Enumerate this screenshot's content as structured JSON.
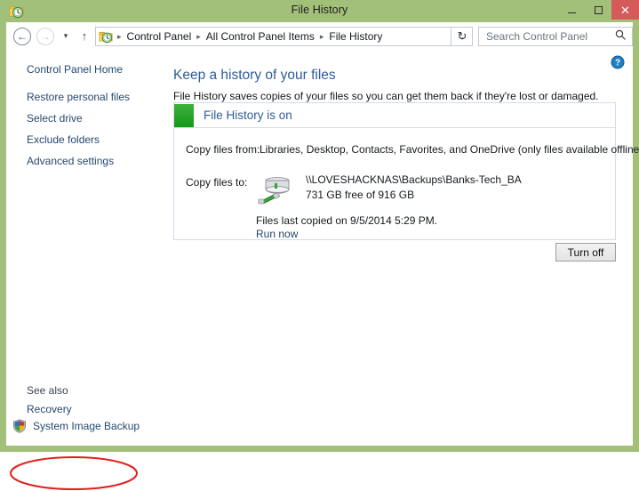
{
  "window": {
    "title": "File History",
    "icon": "file-history-folder-clock-icon",
    "frame_color": "#a3c07a",
    "controls": {
      "minimize": "–",
      "maximize": "□",
      "close": "✕",
      "close_color": "#d55b5b"
    }
  },
  "nav": {
    "back": "←",
    "forward": "→",
    "recent": "▾",
    "up": "↑",
    "address_icon": "file-history-folder-clock-icon",
    "breadcrumbs": [
      "Control Panel",
      "All Control Panel Items",
      "File History"
    ],
    "separator": "▸",
    "dropdown": "⌄",
    "refresh": "↻"
  },
  "search": {
    "placeholder": "Search Control Panel",
    "value": "",
    "icon": "search-icon"
  },
  "help": {
    "icon": "help-question-icon",
    "glyph": "?"
  },
  "sidebar": {
    "home": "Control Panel Home",
    "items": [
      "Restore personal files",
      "Select drive",
      "Exclude folders",
      "Advanced settings"
    ],
    "see_also_label": "See also",
    "see_also_items": [
      "Recovery",
      "System Image Backup"
    ],
    "shield_icon": "uac-shield-icon"
  },
  "main": {
    "heading": "Keep a history of your files",
    "subheading": "File History saves copies of your files so you can get them back if they're lost or damaged.",
    "status": {
      "title": "File History is on",
      "swatch_color": "#17971c",
      "copy_from_label": "Copy files from:",
      "copy_from_value": "Libraries, Desktop, Contacts, Favorites, and OneDrive (only files available offline)",
      "copy_to_label": "Copy files to:",
      "drive_icon": "network-drive-icon",
      "drive_path": "\\\\LOVESHACKNAS\\Backups\\Banks-Tech_BA",
      "drive_space": "731 GB free of 916 GB",
      "last_copied": "Files last copied on 9/5/2014 5:29 PM.",
      "run_now_label": "Run now"
    },
    "turn_off_label": "Turn off"
  },
  "annotation": {
    "type": "red-ellipse-highlight",
    "target": "System Image Backup",
    "color": "#e02020"
  }
}
